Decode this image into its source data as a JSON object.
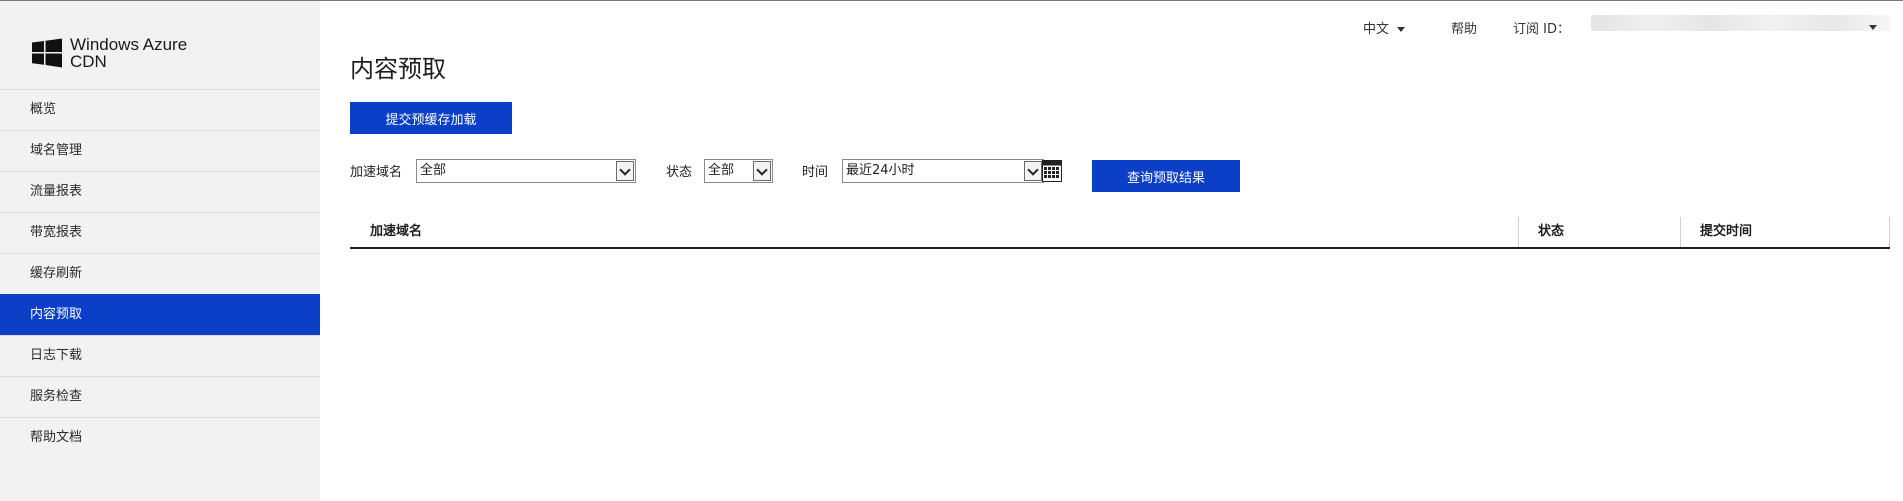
{
  "brand": {
    "line1": "Windows Azure",
    "line2": "CDN"
  },
  "sidebar": {
    "items": [
      {
        "label": "概览"
      },
      {
        "label": "域名管理"
      },
      {
        "label": "流量报表"
      },
      {
        "label": "带宽报表"
      },
      {
        "label": "缓存刷新"
      },
      {
        "label": "内容预取",
        "active": true
      },
      {
        "label": "日志下载"
      },
      {
        "label": "服务检查"
      },
      {
        "label": "帮助文档"
      }
    ]
  },
  "topbar": {
    "language": "中文",
    "help": "帮助",
    "subscription_label": "订阅 ID："
  },
  "page": {
    "title": "内容预取"
  },
  "actions": {
    "submit_preload": "提交预缓存加载",
    "query_results": "查询预取结果"
  },
  "filters": {
    "domain": {
      "label": "加速域名",
      "value": "全部"
    },
    "status": {
      "label": "状态",
      "value": "全部"
    },
    "time": {
      "label": "时间",
      "value": "最近24小时"
    }
  },
  "table": {
    "columns": [
      "加速域名",
      "状态",
      "提交时间"
    ]
  },
  "colors": {
    "accent": "#0b3fc7",
    "sidebar_bg": "#f2f2f2"
  },
  "icons": [
    "windows-logo-icon",
    "chevron-down-icon",
    "calendar-icon"
  ]
}
